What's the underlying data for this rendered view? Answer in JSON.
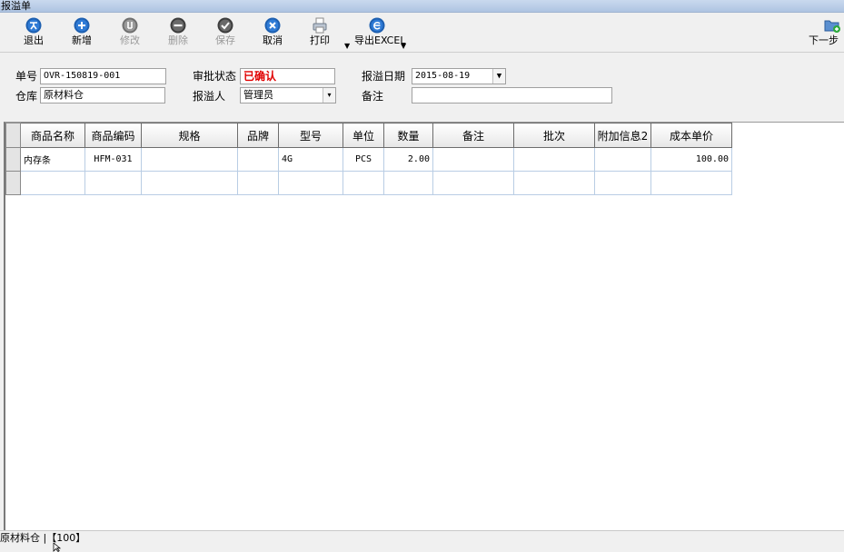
{
  "window": {
    "title": "报溢单"
  },
  "toolbar": {
    "exit": "退出",
    "add": "新增",
    "edit": "修改",
    "delete": "删除",
    "save": "保存",
    "cancel": "取消",
    "print": "打印",
    "export": "导出EXCEL",
    "next": "下一步"
  },
  "form": {
    "order_no_label": "单号",
    "order_no": "OVR-150819-001",
    "warehouse_label": "仓库",
    "warehouse": "原材料仓",
    "approval_label": "审批状态",
    "approval": "已确认",
    "reporter_label": "报溢人",
    "reporter": "管理员",
    "date_label": "报溢日期",
    "date": "2015-08-19",
    "remark_label": "备注",
    "remark": ""
  },
  "grid": {
    "columns": [
      "商品名称",
      "商品编码",
      "规格",
      "品牌",
      "型号",
      "单位",
      "数量",
      "备注",
      "批次",
      "附加信息2",
      "成本单价"
    ],
    "rows": [
      [
        "内存条",
        "HFM-031",
        "",
        "",
        "4G",
        "PCS",
        "2.00",
        "",
        "",
        "",
        "100.00"
      ],
      [
        "",
        "",
        "",
        "",
        "",
        "",
        "",
        "",
        "",
        "",
        ""
      ]
    ]
  },
  "statusbar": {
    "text": "原材料仓 |【100】"
  },
  "colors": {
    "status_confirmed": "#e00000",
    "titlebar": "#b8cce8",
    "grid_line": "#b9cde4"
  },
  "icons": {
    "exit": "exit-person-icon",
    "add": "plus-circle-icon",
    "edit": "edit-circle-icon",
    "delete": "minus-circle-icon",
    "save": "check-circle-icon",
    "cancel": "x-circle-icon",
    "print": "printer-icon",
    "export": "export-e-icon",
    "next": "folder-next-icon"
  }
}
